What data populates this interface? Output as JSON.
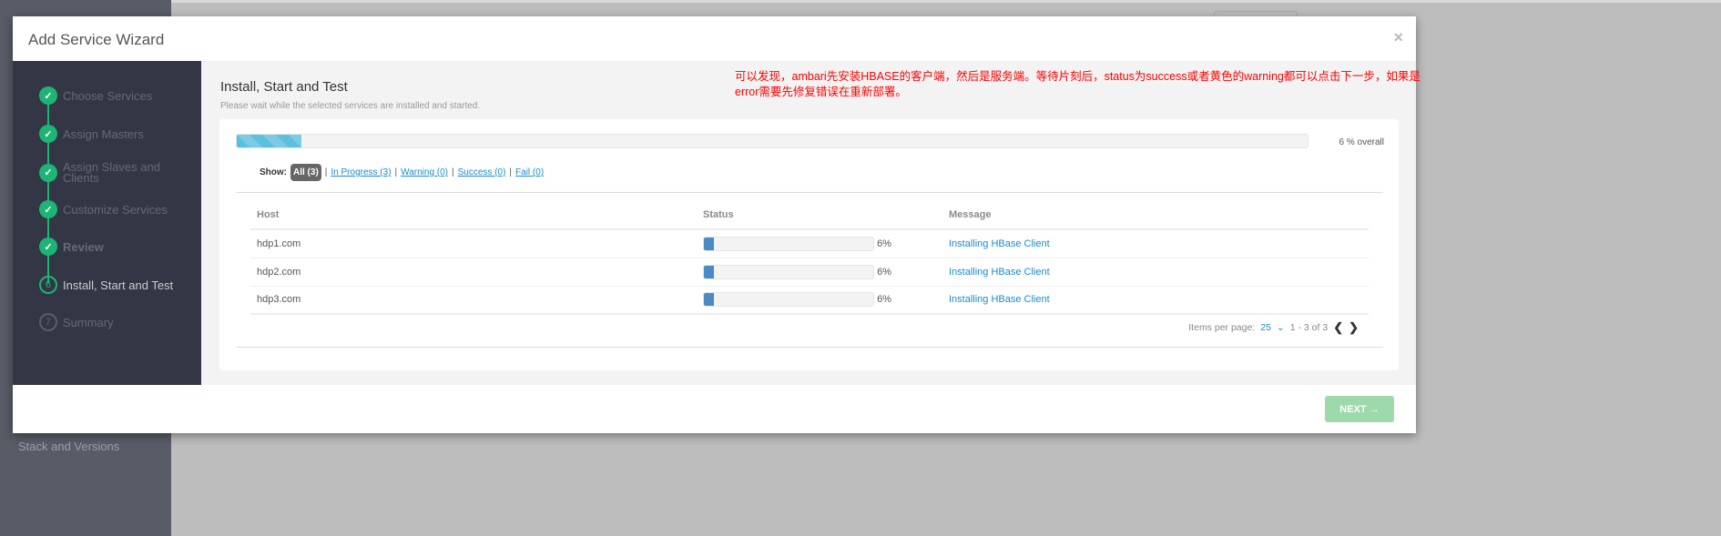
{
  "background": {
    "sidebar_item": "Stack and Versions"
  },
  "modal": {
    "title": "Add Service Wizard",
    "close": "×"
  },
  "steps": [
    {
      "label": "Choose Services",
      "state": "done",
      "marker": "✓"
    },
    {
      "label": "Assign Masters",
      "state": "done",
      "marker": "✓"
    },
    {
      "label": "Assign Slaves and Clients",
      "state": "done",
      "marker": "✓"
    },
    {
      "label": "Customize Services",
      "state": "done",
      "marker": "✓"
    },
    {
      "label": "Review",
      "state": "done",
      "marker": "✓"
    },
    {
      "label": "Install, Start and Test",
      "state": "current",
      "marker": "6"
    },
    {
      "label": "Summary",
      "state": "todo",
      "marker": "7"
    }
  ],
  "main": {
    "title": "Install, Start and Test",
    "subtitle": "Please wait while the selected services are installed and started.",
    "annotation": "可以发现，ambari先安装HBASE的客户端，然后是服务端。等待片刻后，status为success或者黄色的warning都可以点击下一步，如果是error需要先修复错误在重新部署。",
    "overall_progress_percent": 6,
    "overall_text": "6 % overall",
    "filters": {
      "label": "Show:",
      "all": "All (3)",
      "in_progress": "In Progress (3)",
      "warning": "Warning (0)",
      "success": "Success (0)",
      "fail": "Fail (0)",
      "separator": "|"
    },
    "table": {
      "headers": [
        "Host",
        "Status",
        "Message"
      ],
      "rows": [
        {
          "host": "hdp1.com",
          "progress": 6,
          "percent": "6%",
          "message": "Installing HBase Client"
        },
        {
          "host": "hdp2.com",
          "progress": 6,
          "percent": "6%",
          "message": "Installing HBase Client"
        },
        {
          "host": "hdp3.com",
          "progress": 6,
          "percent": "6%",
          "message": "Installing HBase Client"
        }
      ]
    },
    "pager": {
      "label": "Items per page:",
      "value": "25",
      "range": "1 - 3 of 3",
      "prev": "❮",
      "next": "❯"
    }
  },
  "footer": {
    "next_label": "NEXT →"
  }
}
